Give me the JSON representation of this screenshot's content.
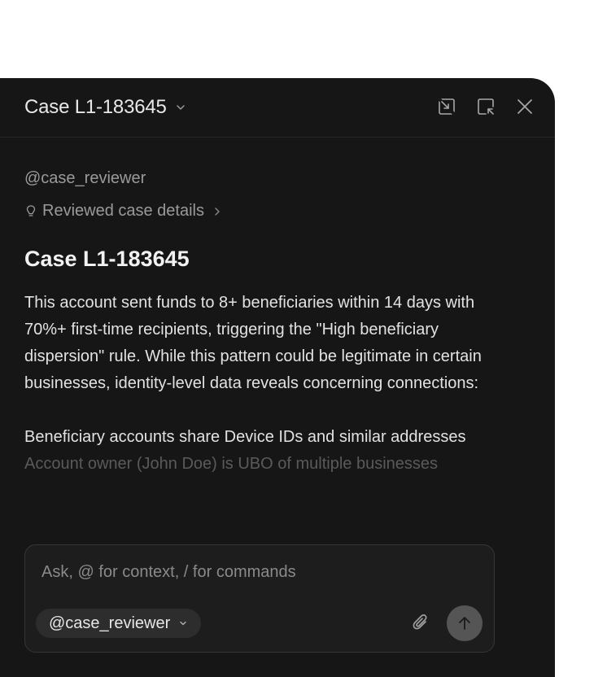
{
  "header": {
    "title": "Case L1-183645",
    "title_icon": "chevron-down-icon",
    "actions": [
      {
        "icon": "collapse-panel-icon"
      },
      {
        "icon": "open-external-icon"
      },
      {
        "icon": "close-icon"
      }
    ]
  },
  "conversation": {
    "agent_mention": "@case_reviewer",
    "reviewed_label": "Reviewed case details",
    "reviewed_icon": "lightbulb-icon",
    "case_heading": "Case L1-183645",
    "paragraph_1": "This account sent funds to 8+ beneficiaries within 14 days with 70%+ first-time recipients, triggering the \"High beneficiary dispersion\" rule. While this pattern could be legitimate in certain businesses, identity-level data reveals concerning connections:",
    "paragraph_2": "Beneficiary accounts share Device IDs and similar addresses",
    "faded_line": "Account owner (John Doe) is UBO of multiple businesses"
  },
  "composer": {
    "placeholder": "Ask, @ for context, / for commands",
    "value": "",
    "agent_selector": "@case_reviewer",
    "attach_icon": "paperclip-icon",
    "send_icon": "arrow-up-icon"
  },
  "colors": {
    "panel_bg": "#161616",
    "composer_bg": "#1d1d1d",
    "send_button": "#555555",
    "text_primary": "#e6e6e6",
    "text_muted": "#9a9a9a"
  }
}
